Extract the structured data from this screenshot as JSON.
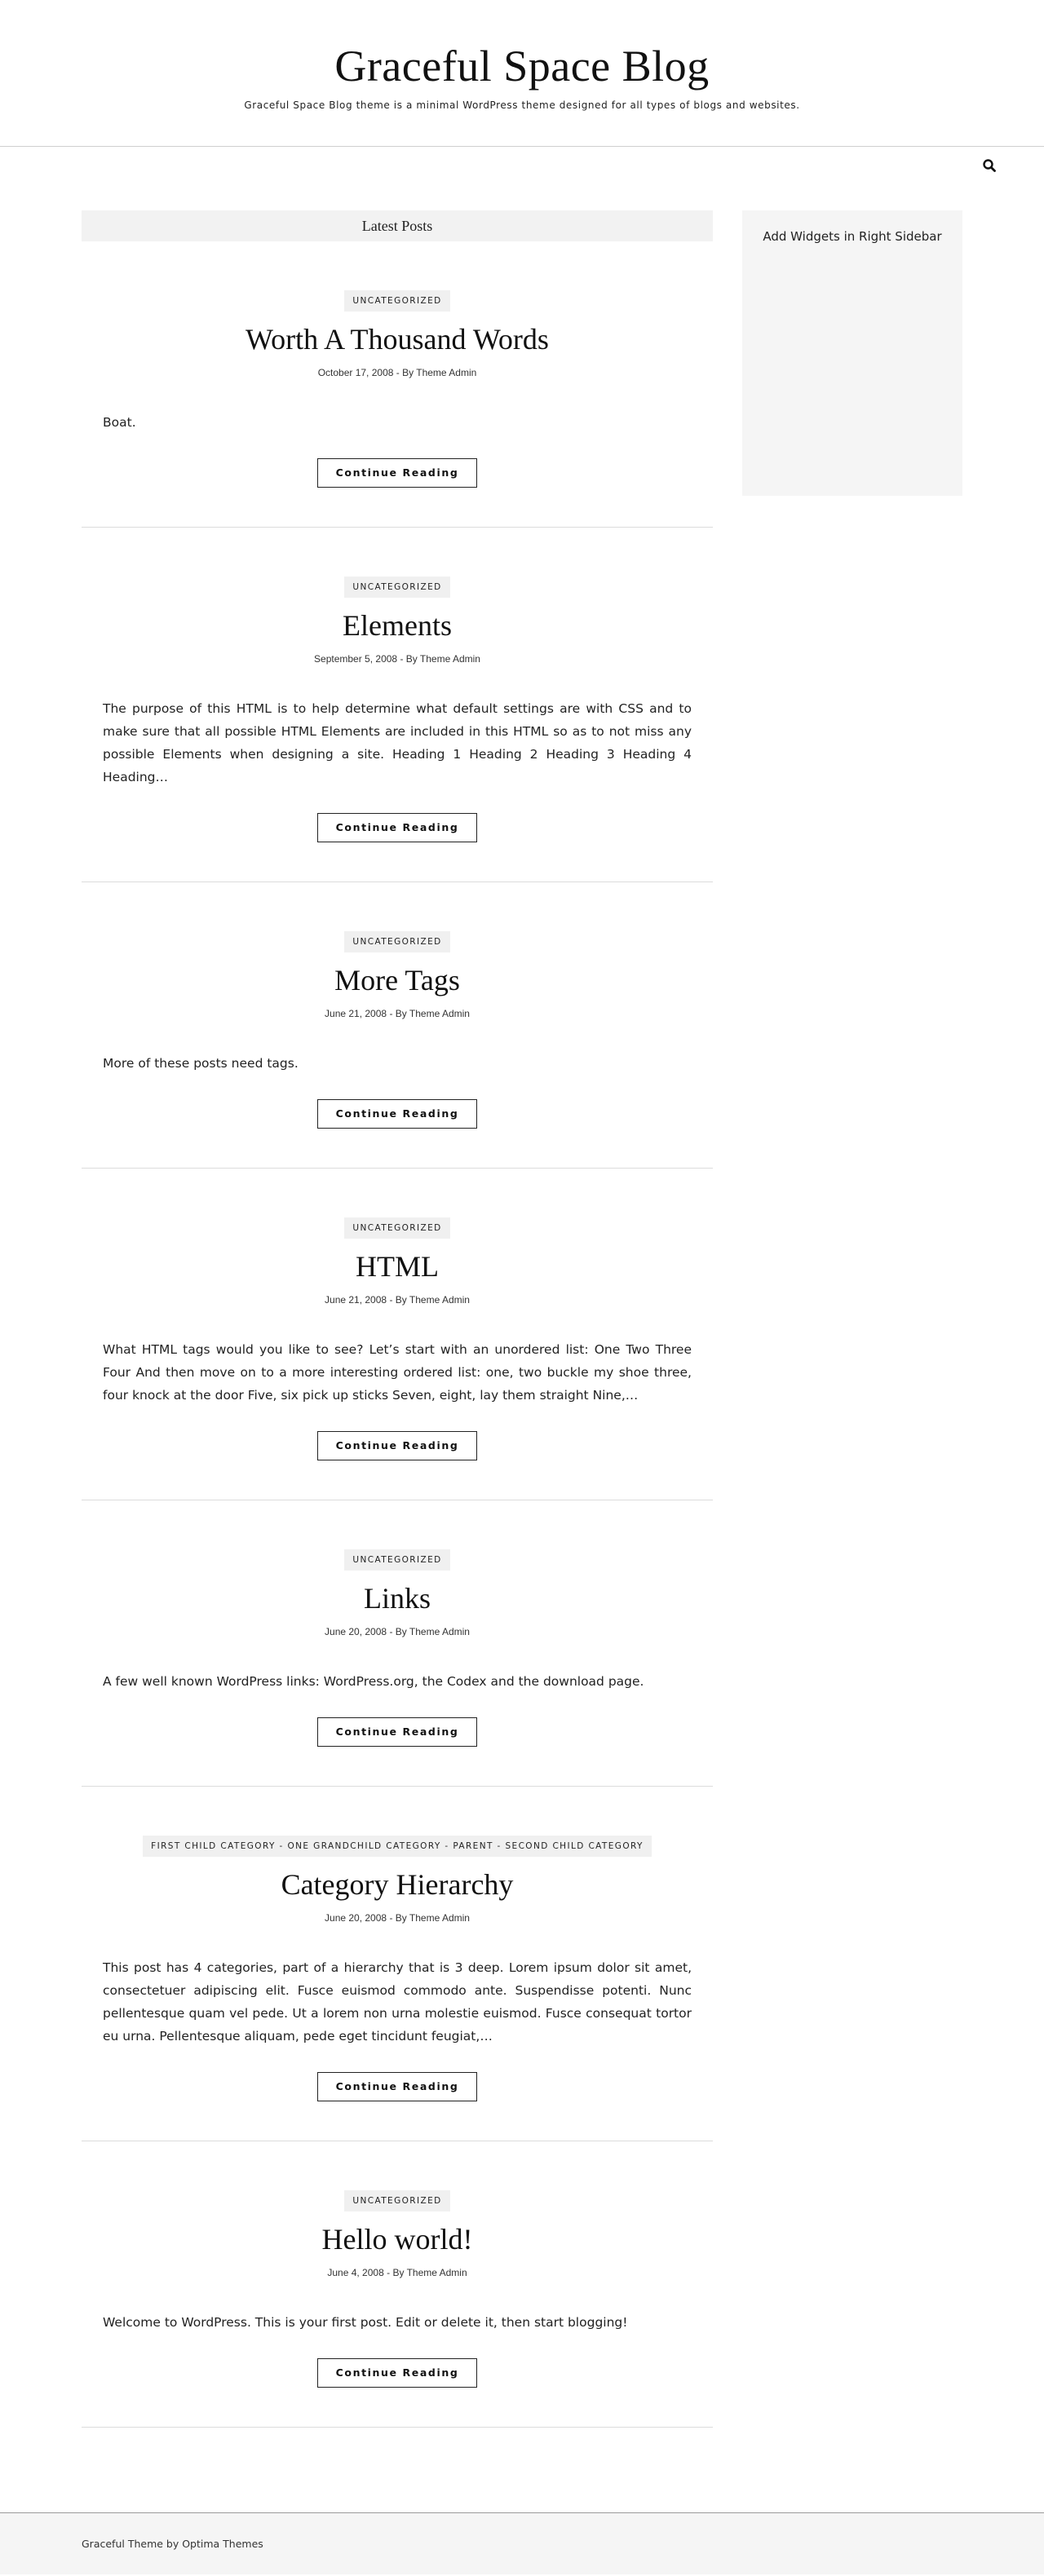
{
  "header": {
    "site_title": "Graceful Space Blog",
    "tagline": "Graceful Space Blog theme is a minimal WordPress theme designed for all types of blogs and websites."
  },
  "nav": {
    "search_icon": "search-icon"
  },
  "main": {
    "section_title": "Latest Posts",
    "read_more_label": "Continue Reading",
    "posts": [
      {
        "categories": [
          "UNCATEGORIZED"
        ],
        "title": "Worth A Thousand Words",
        "date": "October 17, 2008",
        "author_prefix": "By",
        "author": "Theme Admin",
        "excerpt": "Boat."
      },
      {
        "categories": [
          "UNCATEGORIZED"
        ],
        "title": "Elements",
        "date": "September 5, 2008",
        "author_prefix": "By",
        "author": "Theme Admin",
        "excerpt": "The purpose of this HTML is to help determine what default settings are with CSS and to make sure that all possible HTML Elements are included in this HTML so as to not miss any possible Elements when designing a site. Heading 1 Heading 2 Heading 3 Heading 4 Heading…"
      },
      {
        "categories": [
          "UNCATEGORIZED"
        ],
        "title": "More Tags",
        "date": "June 21, 2008",
        "author_prefix": "By",
        "author": "Theme Admin",
        "excerpt": "More of these posts need tags."
      },
      {
        "categories": [
          "UNCATEGORIZED"
        ],
        "title": "HTML",
        "date": "June 21, 2008",
        "author_prefix": "By",
        "author": "Theme Admin",
        "excerpt": "What HTML tags would you like to see? Let’s start with an unordered list: One Two Three Four And then move on to a more interesting ordered list: one, two buckle my shoe three, four knock at the door Five, six pick up sticks Seven, eight, lay them straight Nine,…"
      },
      {
        "categories": [
          "UNCATEGORIZED"
        ],
        "title": "Links",
        "date": "June 20, 2008",
        "author_prefix": "By",
        "author": "Theme Admin",
        "excerpt": "A few well known WordPress links: WordPress.org, the Codex and the download page."
      },
      {
        "categories": [
          "FIRST CHILD CATEGORY",
          "ONE GRANDCHILD CATEGORY",
          "PARENT",
          "SECOND CHILD CATEGORY"
        ],
        "title": "Category Hierarchy",
        "date": "June 20, 2008",
        "author_prefix": "By",
        "author": "Theme Admin",
        "excerpt": "This post has 4 categories, part of a hierarchy that is 3 deep. Lorem ipsum dolor sit amet, consectetuer adipiscing elit. Fusce euismod commodo ante. Suspendisse potenti. Nunc pellentesque quam vel pede. Ut a lorem non urna molestie euismod. Fusce consequat tortor eu urna. Pellentesque aliquam, pede eget tincidunt feugiat,…"
      },
      {
        "categories": [
          "UNCATEGORIZED"
        ],
        "title": "Hello world!",
        "date": "June 4, 2008",
        "author_prefix": "By",
        "author": "Theme Admin",
        "excerpt": "Welcome to WordPress. This is your first post. Edit or delete it, then start blogging!"
      }
    ]
  },
  "sidebar": {
    "widget_text": "Add Widgets in Right Sidebar"
  },
  "footer": {
    "text": "Graceful Theme by Optima Themes"
  },
  "colors": {
    "background": "#ffffff",
    "panel": "#f5f5f5",
    "text": "#222222",
    "border": "#dcdcdc"
  }
}
